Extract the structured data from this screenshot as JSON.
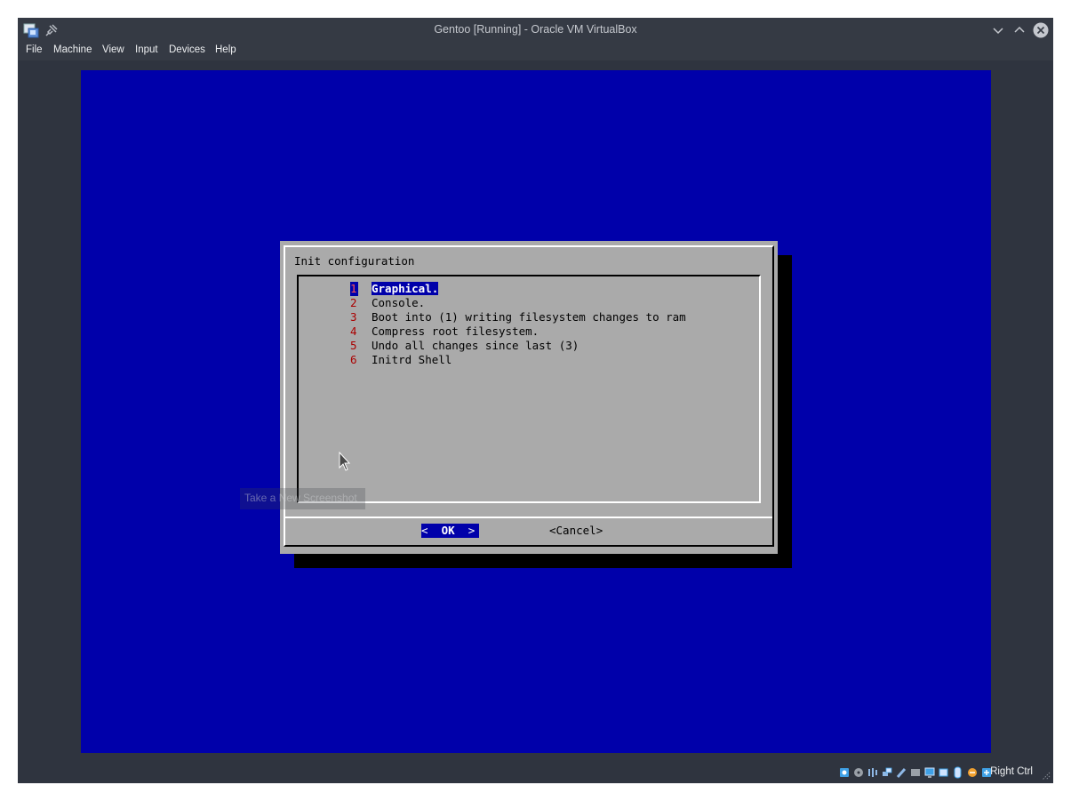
{
  "window": {
    "title": "Gentoo [Running] - Oracle VM VirtualBox"
  },
  "menubar": {
    "items": [
      "File",
      "Machine",
      "View",
      "Input",
      "Devices",
      "Help"
    ]
  },
  "dialog": {
    "title": "Init configuration",
    "items": [
      {
        "num": "1",
        "label": "Graphical.",
        "selected": true
      },
      {
        "num": "2",
        "label": "Console.",
        "selected": false
      },
      {
        "num": "3",
        "label": "Boot into (1) writing filesystem changes to ram",
        "selected": false
      },
      {
        "num": "4",
        "label": "Compress root filesystem.",
        "selected": false
      },
      {
        "num": "5",
        "label": "Undo all changes since last (3)",
        "selected": false
      },
      {
        "num": "6",
        "label": "Initrd Shell",
        "selected": false
      }
    ],
    "ok_label": "OK",
    "cancel_label": "Cancel"
  },
  "tooltip": {
    "text": "Take a New Screenshot"
  },
  "statusbar": {
    "icons": [
      "hard-disk-icon",
      "optical-drive-icon",
      "audio-icon",
      "network-icon",
      "usb-icon",
      "shared-folders-icon",
      "display-icon",
      "recording-icon",
      "mouse-integration-icon",
      "cpu-icon",
      "keyboard-capture-icon"
    ],
    "host_key": "Right Ctrl"
  },
  "colors": {
    "vm_background": "#0000aa",
    "dialog_gray": "#aaaaaa",
    "hotkey_red": "#aa0000",
    "selection_blue": "#0000aa"
  }
}
